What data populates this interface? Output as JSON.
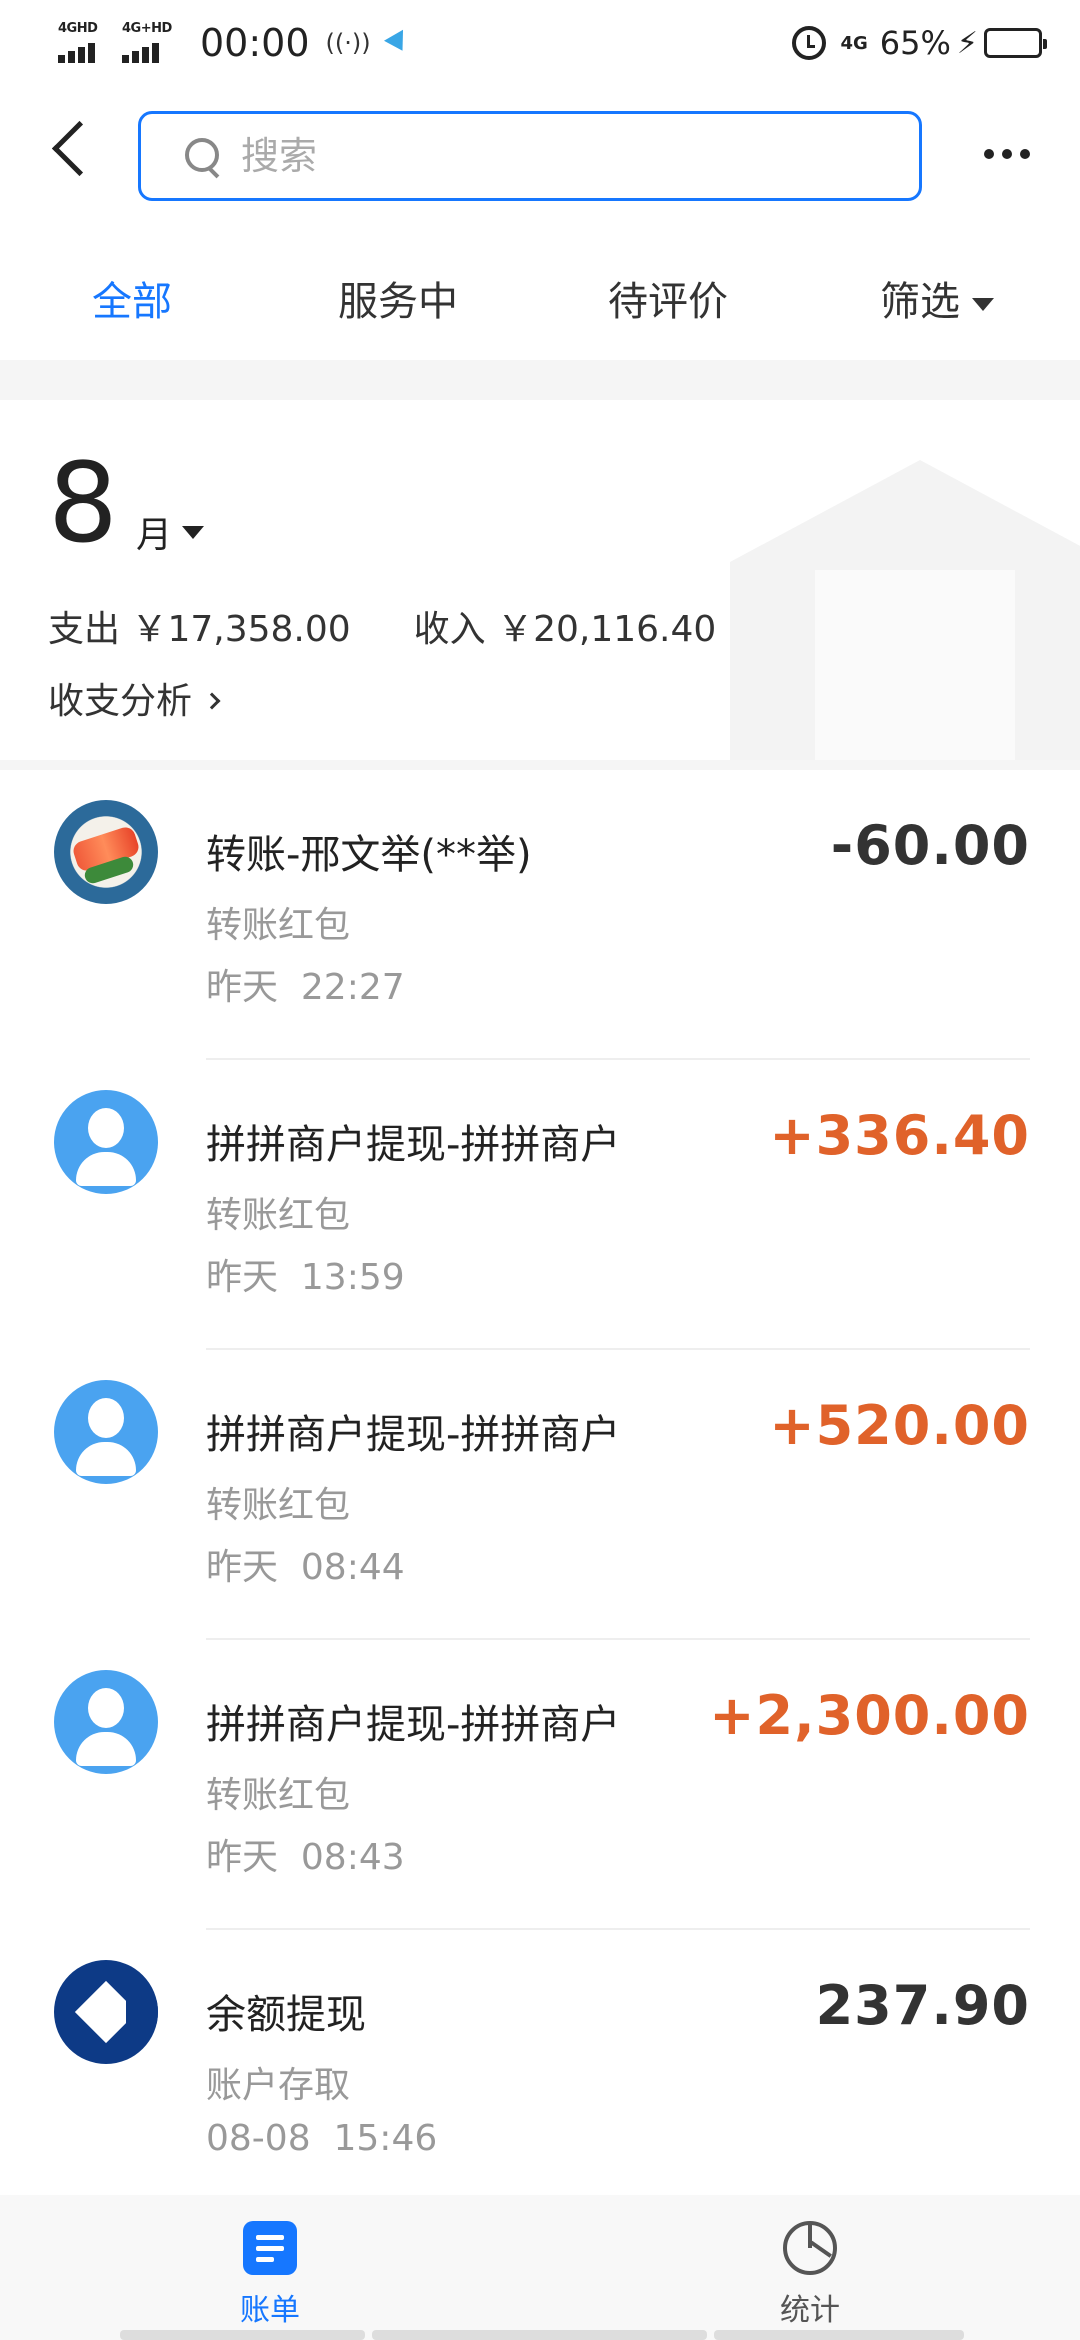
{
  "status_bar": {
    "signal1_label": "4GHD",
    "signal2_label": "4G+HD",
    "time": "00:00",
    "radio_icon": "((·))",
    "net_label": "4G",
    "battery_percent": "65%",
    "battery_level": 0.65
  },
  "search": {
    "placeholder": "搜索"
  },
  "tabs": [
    {
      "label": "全部",
      "active": true
    },
    {
      "label": "服务中",
      "active": false
    },
    {
      "label": "待评价",
      "active": false
    },
    {
      "label": "筛选",
      "active": false
    }
  ],
  "summary": {
    "month": "8",
    "month_unit": "月",
    "expense_label": "支出",
    "expense_value": "￥17,358.00",
    "income_label": "收入",
    "income_value": "￥20,116.40",
    "analysis_link": "收支分析"
  },
  "transactions": [
    {
      "title": "转账-邢文举(**举)",
      "category": "转账红包",
      "date": "昨天",
      "time": "22:27",
      "amount": "-60.00",
      "avatar": "food-photo",
      "income": false
    },
    {
      "title": "拼拼商户提现-拼拼商户",
      "category": "转账红包",
      "date": "昨天",
      "time": "13:59",
      "amount": "+336.40",
      "avatar": "person-icon",
      "income": true
    },
    {
      "title": "拼拼商户提现-拼拼商户",
      "category": "转账红包",
      "date": "昨天",
      "time": "08:44",
      "amount": "+520.00",
      "avatar": "person-icon",
      "income": true
    },
    {
      "title": "拼拼商户提现-拼拼商户",
      "category": "转账红包",
      "date": "昨天",
      "time": "08:43",
      "amount": "+2,300.00",
      "avatar": "person-icon",
      "income": true
    },
    {
      "title": "余额提现",
      "category": "账户存取",
      "date": "08-08",
      "time": "15:46",
      "amount": "237.90",
      "avatar": "bank-logo",
      "income": false
    }
  ],
  "bottom_nav": [
    {
      "label": "账单",
      "icon": "bill-icon",
      "active": true
    },
    {
      "label": "统计",
      "icon": "pie-chart-icon",
      "active": false
    }
  ],
  "colors": {
    "accent": "#1677ff",
    "income": "#e0622a",
    "avatar_blue": "#4aa3f0"
  }
}
